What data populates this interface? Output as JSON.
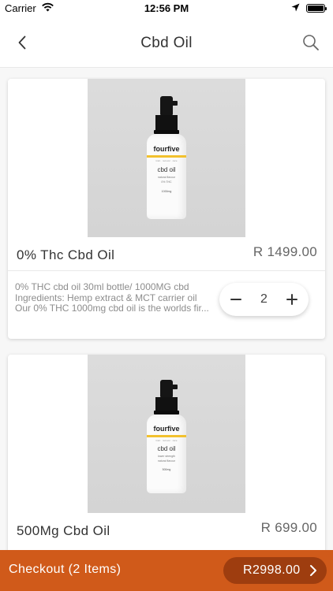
{
  "status_bar": {
    "carrier": "Carrier",
    "time": "12:56 PM",
    "icons": [
      "wifi-icon",
      "location-arrow-icon",
      "battery-icon"
    ]
  },
  "header": {
    "title": "Cbd Oil",
    "back_icon": "chevron-left-icon",
    "search_icon": "search-icon"
  },
  "products": [
    {
      "name": "0% Thc Cbd Oil",
      "price": "R 1499.00",
      "image_text": {
        "brand": "fourfive",
        "tagline": "train · recover · race",
        "product": "cbd oil",
        "line1": "natural flavour",
        "line2": "0% THC",
        "strength": "1000mg"
      },
      "description_lines": [
        "0% THC cbd oil 30ml bottle/ 1000MG cbd",
        "Ingredients: Hemp extract & MCT carrier oil",
        "Our 0% THC 1000mg cbd oil is the worlds fir..."
      ],
      "quantity": "2",
      "decrement_icon": "minus-icon",
      "increment_icon": "plus-icon"
    },
    {
      "name": "500Mg Cbd Oil",
      "price": "R 699.00",
      "image_text": {
        "brand": "fourfive",
        "tagline": "train · recover · race",
        "product": "cbd oil",
        "line1": "lower strength",
        "line2": "natural flavour",
        "strength": "500mg"
      }
    }
  ],
  "checkout": {
    "label": "Checkout (2 Items)",
    "total": "R2998.00",
    "chevron_icon": "chevron-right-icon"
  },
  "colors": {
    "accent": "#d05a1a",
    "accent_dark": "#9e3d0f",
    "label_yellow": "#f2c12e"
  }
}
